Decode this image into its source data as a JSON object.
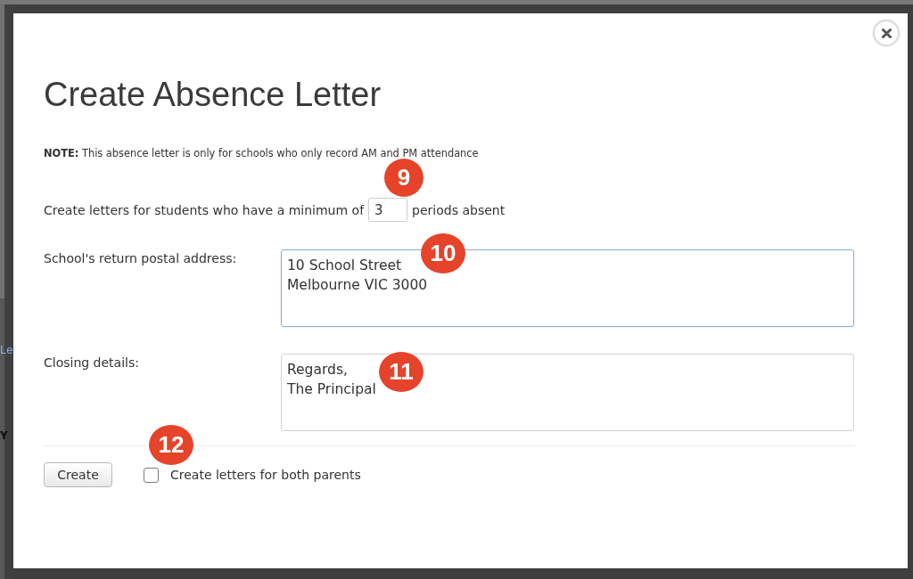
{
  "background_page": {
    "link_fragment": "Le",
    "text_fragment": "Y"
  },
  "dialog": {
    "title": "Create Absence Letter",
    "note": "**NOTE:** This absence letter is only for schools who only record AM and PM attendance",
    "minimum_row": {
      "label_before": "Create letters for students who have a minimum of",
      "value": "3",
      "label_after": "periods absent"
    },
    "fields": [
      {
        "label": "School's return postal address:",
        "value": "10 School Street\nMelbourne VIC 3000",
        "focused": true
      },
      {
        "label": "Closing details:",
        "value": "Regards,\nThe Principal",
        "focused": false
      }
    ],
    "create_button": "Create",
    "both_parents_checkbox": {
      "label": "Create letters for both parents",
      "checked": false
    }
  },
  "callouts": [
    {
      "number": "9"
    },
    {
      "number": "10"
    },
    {
      "number": "11"
    },
    {
      "number": "12"
    }
  ]
}
